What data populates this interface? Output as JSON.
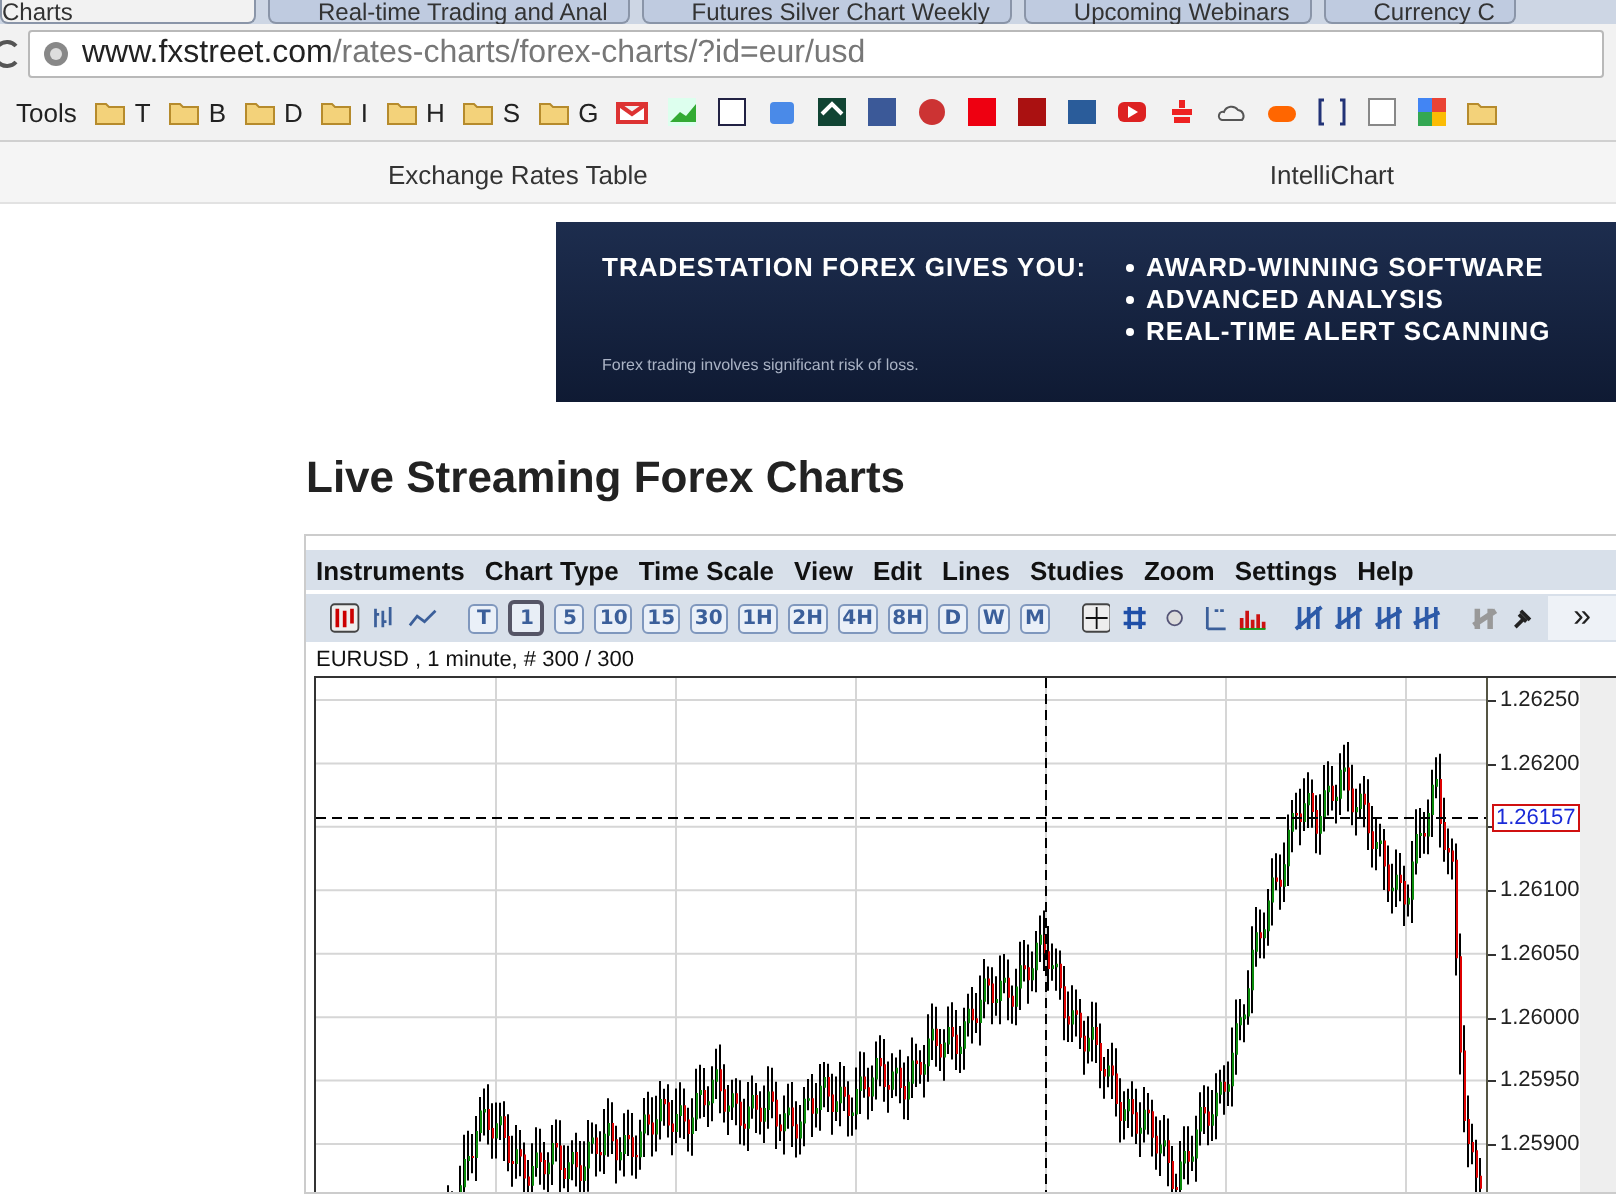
{
  "browser": {
    "tabs": [
      {
        "label": "Charts",
        "selected": true
      },
      {
        "label": "Real-time Trading and Anal",
        "selected": false
      },
      {
        "label": "Futures Silver Chart Weekly",
        "selected": false
      },
      {
        "label": "Upcoming Webinars",
        "selected": false
      },
      {
        "label": "Currency C",
        "selected": false
      }
    ],
    "url": {
      "host": "www.fxstreet.com",
      "path": "/rates-charts/forex-charts/?id=eur/usd"
    },
    "bookmarks": {
      "apps": "Tools",
      "folders": [
        "T",
        "B",
        "D",
        "I",
        "H",
        "S",
        "G"
      ]
    }
  },
  "site_nav": {
    "links": [
      "Exchange Rates Table",
      "IntelliChart"
    ]
  },
  "banner": {
    "headline": "TRADESTATION FOREX GIVES YOU:",
    "bullets": [
      "AWARD-WINNING SOFTWARE",
      "ADVANCED ANALYSIS",
      "REAL-TIME ALERT SCANNING"
    ],
    "disclaimer": "Forex trading involves significant risk of loss."
  },
  "page_title": "Live Streaming Forex Charts",
  "chart_app": {
    "menu": [
      "Instruments",
      "Chart Type",
      "Time Scale",
      "View",
      "Edit",
      "Lines",
      "Studies",
      "Zoom",
      "Settings",
      "Help"
    ],
    "timeframes": [
      {
        "label": "T",
        "selected": false
      },
      {
        "label": "1",
        "selected": true
      },
      {
        "label": "5",
        "selected": false
      },
      {
        "label": "10",
        "selected": false
      },
      {
        "label": "15",
        "selected": false
      },
      {
        "label": "30",
        "selected": false
      },
      {
        "label": "1H",
        "selected": false
      },
      {
        "label": "2H",
        "selected": false
      },
      {
        "label": "4H",
        "selected": false
      },
      {
        "label": "8H",
        "selected": false
      },
      {
        "label": "D",
        "selected": false
      },
      {
        "label": "W",
        "selected": false
      },
      {
        "label": "M",
        "selected": false
      }
    ],
    "more": "»",
    "info": "EURUSD , 1 minute, # 300 / 300",
    "price_axis": [
      "1.26250",
      "1.26200",
      "1.26100",
      "1.26050",
      "1.26000",
      "1.25950",
      "1.25900"
    ],
    "current_price": "1.26157"
  }
}
